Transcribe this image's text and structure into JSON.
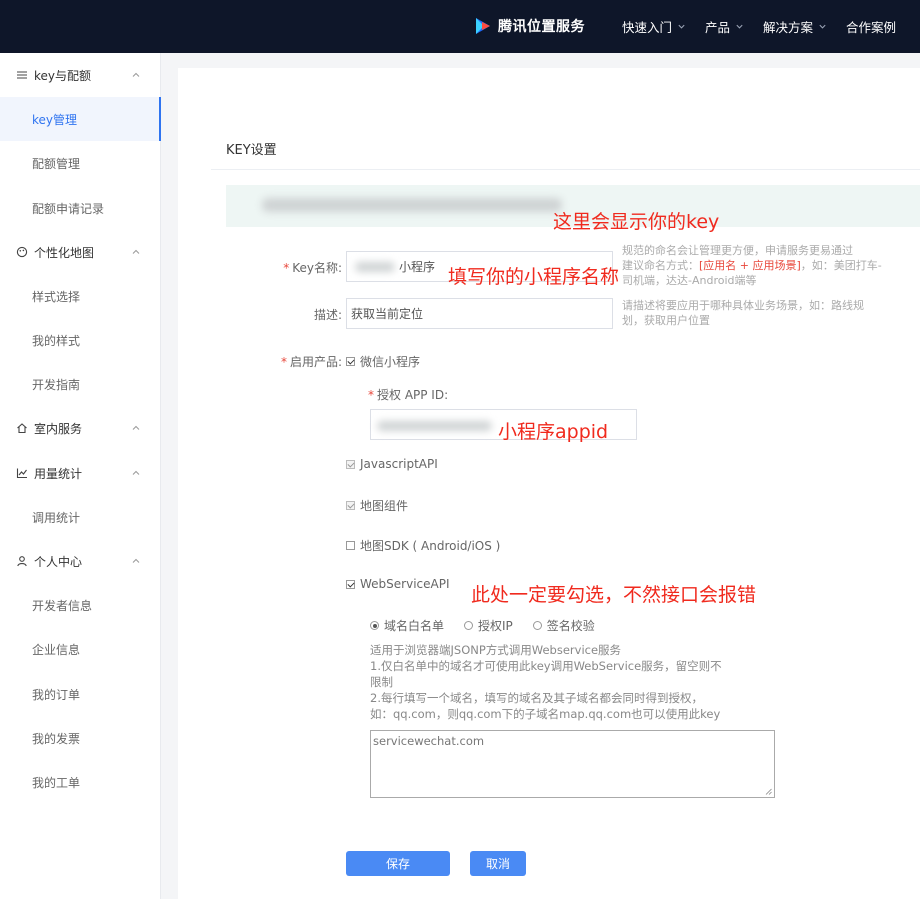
{
  "header": {
    "brand": "腾讯位置服务",
    "nav": [
      {
        "label": "快速入门",
        "has_dropdown": true
      },
      {
        "label": "产品",
        "has_dropdown": true
      },
      {
        "label": "解决方案",
        "has_dropdown": true
      },
      {
        "label": "合作案例",
        "has_dropdown": false
      }
    ]
  },
  "sidebar": {
    "groups": [
      {
        "label": "key与配额",
        "icon": "list-icon",
        "items": [
          "key管理",
          "配额管理",
          "配额申请记录"
        ]
      },
      {
        "label": "个性化地图",
        "icon": "palette-icon",
        "items": [
          "样式选择",
          "我的样式",
          "开发指南"
        ]
      },
      {
        "label": "室内服务",
        "icon": "home-icon",
        "items": []
      },
      {
        "label": "用量统计",
        "icon": "chart-icon",
        "items": [
          "调用统计"
        ]
      },
      {
        "label": "个人中心",
        "icon": "user-icon",
        "items": [
          "开发者信息",
          "企业信息",
          "我的订单",
          "我的发票",
          "我的工单"
        ]
      }
    ],
    "active_item": "key管理"
  },
  "form": {
    "section_title": "KEY设置",
    "key_name": {
      "label": "Key名称:",
      "value": "小程序",
      "hint_part1": "规范的命名会让管理更方便，申请服务更易通过",
      "hint_part2": "建议命名方式：",
      "hint_highlight": "[应用名 + 应用场景]",
      "hint_part3": "，如：美团打车-",
      "hint_part4": "司机端，达达-Android端等"
    },
    "description": {
      "label": "描述:",
      "value": "获取当前定位",
      "hint_line1": "请描述将要应用于哪种具体业务场景，如：路线规",
      "hint_line2": "划，获取用户位置"
    },
    "products": {
      "label": "启用产品:",
      "wechat": {
        "label": "微信小程序",
        "checked": true
      },
      "appid_label": "授权 APP ID:",
      "javascript_api": {
        "label": "JavascriptAPI",
        "checked": true
      },
      "map_component": {
        "label": "地图组件",
        "checked": true
      },
      "map_sdk": {
        "label": "地图SDK ( Android/iOS )",
        "checked": false
      },
      "webservice": {
        "label": "WebServiceAPI",
        "checked": true
      }
    },
    "auth_modes": [
      {
        "label": "域名白名单",
        "checked": true
      },
      {
        "label": "授权IP",
        "checked": false
      },
      {
        "label": "签名校验",
        "checked": false
      }
    ],
    "whitelist_desc": [
      "适用于浏览器端JSONP方式调用Webservice服务",
      "1.仅白名单中的域名才可使用此key调用WebService服务，留空则不",
      "限制",
      "2.每行填写一个域名，填写的域名及其子域名都会同时得到授权，",
      "如：qq.com，则qq.com下的子域名map.qq.com也可以使用此key"
    ],
    "whitelist_value": "servicewechat.com",
    "save_label": "保存",
    "cancel_label": "取消"
  },
  "annotations": {
    "key_display": "这里会显示你的key",
    "fill_name": "填写你的小程序名称",
    "appid": "小程序appid",
    "must_check": "此处一定要勾选，不然接口会报错"
  },
  "colors": {
    "topbar": "#0e1629",
    "accent": "#2f74f0",
    "button": "#4a8af4",
    "required": "#e8473b",
    "annotation": "#f02a1e"
  }
}
